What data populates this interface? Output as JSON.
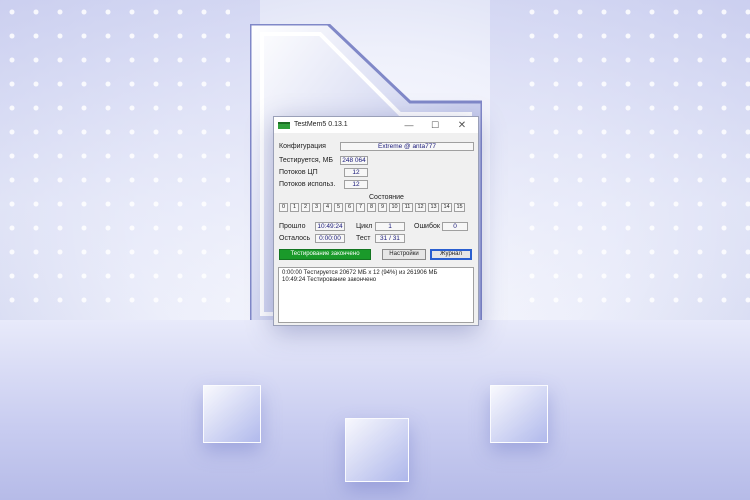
{
  "window": {
    "title": "TestMem5  0.13.1",
    "controls": {
      "minimize": "—",
      "maximize": "☐",
      "close": "✕"
    }
  },
  "info": {
    "config_label": "Конфигурация",
    "config_value": "Extreme @ anta777",
    "tested_label": "Тестируется, МБ",
    "tested_value": "248 064",
    "cpu_threads_label": "Потоков ЦП",
    "cpu_threads_value": "12",
    "used_threads_label": "Потоков использ.",
    "used_threads_value": "12"
  },
  "status": {
    "heading": "Состояние",
    "threads": [
      "0",
      "1",
      "2",
      "3",
      "4",
      "5",
      "6",
      "7",
      "8",
      "9",
      "10",
      "11",
      "12",
      "13",
      "14",
      "15"
    ]
  },
  "timing": {
    "elapsed_label": "Прошло",
    "elapsed_value": "10:49:24",
    "remaining_label": "Осталось",
    "remaining_value": "0:00:00",
    "cycle_label": "Цикл",
    "cycle_value": "1",
    "test_label": "Тест",
    "test_value": "31 / 31",
    "errors_label": "Ошибок",
    "errors_value": "0"
  },
  "buttons": {
    "status_button": "Тестирование закончено",
    "settings": "Настройки",
    "journal": "Журнал"
  },
  "log": [
    "0:00:00  Тестируется 20672 МБ x 12 (94%) из 261906 МБ",
    "10:49:24  Тестирование закончено"
  ],
  "colors": {
    "accent_green": "#1a9a2a",
    "value_text": "#1a1a7a"
  }
}
